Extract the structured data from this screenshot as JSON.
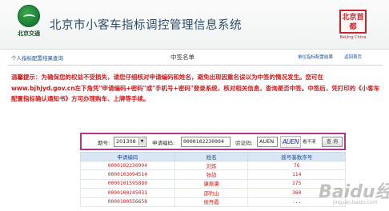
{
  "header": {
    "logo_text": "北京交通",
    "site_title": "北京市小客车指标调控管理信息系统",
    "seal_text": "北京首都",
    "seal_sub": "Beijing China"
  },
  "subnav": {
    "left_link": "个人指标配置结果查询",
    "center_title": "中签名单",
    "right_link_1": "单位指标配置结果",
    "right_link_2": "返回首页"
  },
  "notice": {
    "text": "温馨提示：为确保您的权益不受损失，请您仔细核对申请编码和姓名，避免出现因重名误以为中签的情况发生。您可在www.bjhjyd.gov.cn左下角凭\"申请编码+密码\"或\"手机号+密码\"登录系统，核对相关信息，查询是否中签。中签后，凭打印的《小客车配置指标确认通知书》方可办理购车、上牌等手续。"
  },
  "query": {
    "period_label": "期号:",
    "period_value": "201308",
    "code_label": "申请编码:",
    "code_value": "0000102230994",
    "captcha_label": "验证码:",
    "captcha_value": "AUEN",
    "captcha_image": "AUEN",
    "refresh_label": "看不清",
    "search_button": "查 询"
  },
  "table": {
    "headers": [
      "申请编码",
      "姓名",
      "摇号基数序号"
    ],
    "rows": [
      [
        "0000102230994",
        "刘炼",
        "76"
      ],
      [
        "0000103094514",
        "张劼",
        "114"
      ],
      [
        "0000101595880",
        "康振骥",
        "175"
      ],
      [
        "0000100245031",
        "邵豹山",
        "360"
      ],
      [
        "0000100556658",
        "侯丹霞",
        "..."
      ]
    ]
  },
  "watermark": {
    "text": "Baidu经验",
    "sub": "jingyan.baidu.com"
  }
}
